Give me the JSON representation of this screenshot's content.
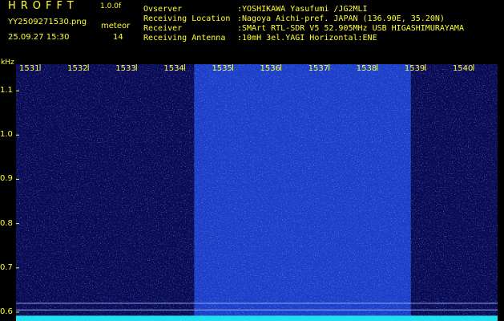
{
  "header": {
    "app_title": "HROFFT",
    "app_version": "1.0.0f",
    "file_name": "YY2509271530.png",
    "mode": "meteor",
    "timestamp": "25.09.27 15:30",
    "count": "14"
  },
  "info": [
    {
      "label": "Ovserver",
      "value": ":YOSHIKAWA Yasufumi /JG2MLI"
    },
    {
      "label": "Receiving Location",
      "value": ":Nagoya Aichi-pref. JAPAN (136.90E, 35.20N)"
    },
    {
      "label": "Receiver",
      "value": ":SMArt RTL-SDR V5 52.905MHz USB HIGASHIMURAYAMA"
    },
    {
      "label": "Receiving Antenna",
      "value": ":10mH 3el.YAGI Horizontal:ENE"
    }
  ],
  "colors": {
    "text": "#ffff33",
    "background": "#000000",
    "spectrogram_dark": "#0a0a55",
    "spectrogram_bright": "#1d3fc8",
    "noise_floor": "#20e0f0"
  },
  "chart_data": {
    "type": "heatmap",
    "xlabel": "",
    "ylabel": "kHz",
    "x_ticks": [
      "1531",
      "1532",
      "1533",
      "1534",
      "1535",
      "1536",
      "1537",
      "1538",
      "1539",
      "1540"
    ],
    "y_ticks": [
      "1.1",
      "1.0",
      "0.9",
      "0.8",
      "0.7",
      "0.6"
    ],
    "xlim": [
      1530.5,
      1540.5
    ],
    "ylim": [
      0.58,
      1.16
    ],
    "bright_band_x": [
      1534.2,
      1538.7
    ],
    "horizontal_lines_khz": [
      0.62,
      0.605,
      0.59
    ]
  }
}
